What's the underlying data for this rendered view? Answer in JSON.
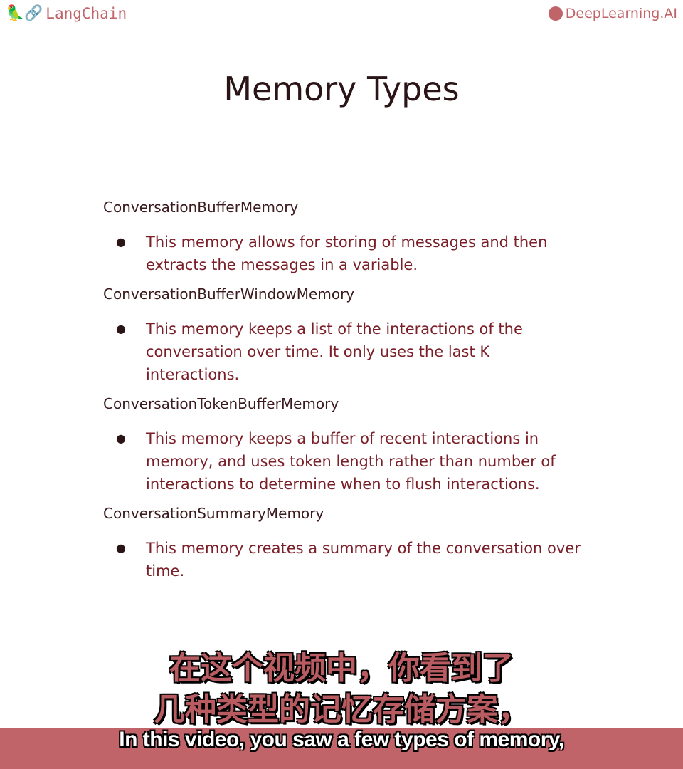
{
  "header": {
    "left_logo": "LangChain",
    "right_logo": "DeepLearning.AI"
  },
  "slide": {
    "title": "Memory Types",
    "sections": [
      {
        "heading": "ConversationBufferMemory",
        "bullet": "This memory allows for storing of messages and then extracts the messages in a variable."
      },
      {
        "heading": "ConversationBufferWindowMemory",
        "bullet": "This memory keeps a list of the interactions of the conversation over time. It only uses the last K interactions."
      },
      {
        "heading": "ConversationTokenBufferMemory",
        "bullet": "This memory keeps a buffer of recent interactions in memory, and uses token length rather than number of interactions to determine when to flush interactions."
      },
      {
        "heading": "ConversationSummaryMemory",
        "bullet": "This memory creates a summary of the conversation over time."
      }
    ]
  },
  "subtitles": {
    "cn_line1": "在这个视频中，你看到了",
    "cn_line2": "几种类型的记忆存储方案，",
    "en": "In this video, you saw a few types of memory,"
  },
  "colors": {
    "accent": "#c0646a",
    "body_text": "#7a1f28"
  }
}
